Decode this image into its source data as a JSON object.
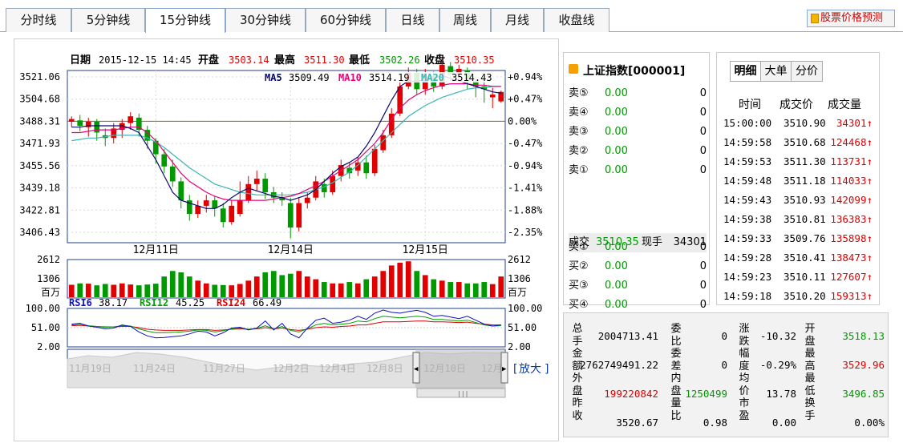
{
  "tabs": [
    "分时线",
    "5分钟线",
    "15分钟线",
    "30分钟线",
    "60分钟线",
    "日线",
    "周线",
    "月线",
    "收盘线"
  ],
  "active_tab": 2,
  "predict_label": "股票价格预测",
  "header": {
    "date_label": "日期",
    "date_value": "2015-12-15 14:45",
    "open_label": "开盘",
    "open_value": "3503.14",
    "high_label": "最高",
    "high_value": "3511.30",
    "low_label": "最低",
    "low_value": "3502.26",
    "close_label": "收盘",
    "close_value": "3510.35"
  },
  "ma": {
    "ma5_label": "MA5",
    "ma5_value": "3509.49",
    "ma10_label": "MA10",
    "ma10_value": "3514.19",
    "ma20_label": "MA20",
    "ma20_value": "3514.43"
  },
  "rsi": {
    "rsi6_label": "RSI6",
    "rsi6_value": "38.17",
    "rsi12_label": "RSI12",
    "rsi12_value": "45.25",
    "rsi24_label": "RSI24",
    "rsi24_value": "66.49"
  },
  "zoom_label": "放大",
  "nav_dates": [
    "11月19日",
    "11月24日",
    "11月27日",
    "12月2日",
    "12月4日",
    "12月8日",
    "12月10日",
    "12月"
  ],
  "colors": {
    "up": "#e00000",
    "down": "#009900",
    "ma5": "#0a0a6e",
    "ma10": "#e8007a",
    "ma20": "#3cb4b4",
    "rsi6": "#1010c8",
    "rsi12": "#00a000",
    "rsi24": "#e00000",
    "accent": "#0b3c9e"
  },
  "chart_data": {
    "type": "candlestick",
    "price_ticks": [
      "3521.06",
      "3504.68",
      "3488.31",
      "3471.93",
      "3455.56",
      "3439.18",
      "3422.81",
      "3406.43"
    ],
    "pct_ticks": [
      "+0.94%",
      "+0.47%",
      "0.00%",
      "-0.47%",
      "-0.94%",
      "-1.41%",
      "-1.88%",
      "-2.35%"
    ],
    "ylim": [
      3406.43,
      3521.06
    ],
    "prev_close": 3488.31,
    "x_ticks": [
      {
        "label": "12月11日",
        "index": 10
      },
      {
        "label": "12月14日",
        "index": 26
      },
      {
        "label": "12月15日",
        "index": 42
      }
    ],
    "candles": [
      [
        3488,
        3490,
        3492,
        3484
      ],
      [
        3489,
        3485,
        3493,
        3481
      ],
      [
        3484,
        3488,
        3491,
        3477
      ],
      [
        3488,
        3480,
        3490,
        3474
      ],
      [
        3478,
        3476,
        3483,
        3470
      ],
      [
        3476,
        3483,
        3487,
        3472
      ],
      [
        3482,
        3487,
        3490,
        3476
      ],
      [
        3487,
        3492,
        3495,
        3482
      ],
      [
        3491,
        3482,
        3494,
        3477
      ],
      [
        3482,
        3474,
        3485,
        3468
      ],
      [
        3474,
        3464,
        3476,
        3457
      ],
      [
        3464,
        3455,
        3468,
        3450
      ],
      [
        3455,
        3444,
        3460,
        3440
      ],
      [
        3444,
        3430,
        3447,
        3424
      ],
      [
        3430,
        3420,
        3434,
        3415
      ],
      [
        3420,
        3426,
        3430,
        3417
      ],
      [
        3426,
        3430,
        3434,
        3421
      ],
      [
        3430,
        3424,
        3433,
        3418
      ],
      [
        3424,
        3414,
        3428,
        3410
      ],
      [
        3414,
        3426,
        3430,
        3412
      ],
      [
        3420,
        3430,
        3444,
        3418
      ],
      [
        3430,
        3442,
        3448,
        3428
      ],
      [
        3442,
        3446,
        3452,
        3437
      ],
      [
        3446,
        3436,
        3450,
        3431
      ],
      [
        3436,
        3432,
        3440,
        3428
      ],
      [
        3432,
        3430,
        3436,
        3426
      ],
      [
        3428,
        3410,
        3432,
        3402
      ],
      [
        3410,
        3428,
        3432,
        3407
      ],
      [
        3428,
        3432,
        3436,
        3424
      ],
      [
        3432,
        3444,
        3448,
        3430
      ],
      [
        3442,
        3436,
        3446,
        3432
      ],
      [
        3436,
        3448,
        3452,
        3434
      ],
      [
        3448,
        3456,
        3460,
        3444
      ],
      [
        3454,
        3450,
        3458,
        3446
      ],
      [
        3452,
        3458,
        3462,
        3448
      ],
      [
        3458,
        3450,
        3463,
        3446
      ],
      [
        3450,
        3468,
        3471,
        3448
      ],
      [
        3467,
        3478,
        3482,
        3465
      ],
      [
        3478,
        3494,
        3498,
        3476
      ],
      [
        3494,
        3514,
        3518,
        3492
      ],
      [
        3514,
        3524,
        3528,
        3512
      ],
      [
        3524,
        3512,
        3527,
        3508
      ],
      [
        3512,
        3522,
        3527,
        3508
      ],
      [
        3522,
        3514,
        3525,
        3510
      ],
      [
        3514,
        3530,
        3534,
        3512
      ],
      [
        3529,
        3523,
        3532,
        3518
      ],
      [
        3523,
        3527,
        3530,
        3519
      ],
      [
        3526,
        3518,
        3528,
        3512
      ],
      [
        3518,
        3514,
        3522,
        3506
      ],
      [
        3514,
        3512,
        3520,
        3502
      ],
      [
        3506,
        3508,
        3513,
        3498
      ],
      [
        3503,
        3510,
        3511,
        3502
      ]
    ],
    "ma5": [
      3484,
      3484,
      3485,
      3485,
      3485,
      3485,
      3485,
      3483,
      3480,
      3470,
      3460,
      3448,
      3436,
      3430,
      3428,
      3426,
      3424,
      3424,
      3427,
      3432,
      3436,
      3439,
      3437,
      3435,
      3433,
      3432,
      3430,
      3432,
      3434,
      3438,
      3444,
      3450,
      3455,
      3458,
      3462,
      3470,
      3480,
      3492,
      3504,
      3514,
      3518,
      3518,
      3519,
      3520,
      3522,
      3520,
      3518,
      3516,
      3514,
      3512,
      3510,
      3509
    ],
    "ma10": [
      3480,
      3480,
      3481,
      3482,
      3482,
      3482,
      3483,
      3484,
      3484,
      3480,
      3474,
      3466,
      3458,
      3450,
      3444,
      3440,
      3436,
      3433,
      3431,
      3430,
      3430,
      3430,
      3430,
      3430,
      3431,
      3432,
      3433,
      3435,
      3438,
      3441,
      3444,
      3448,
      3452,
      3456,
      3460,
      3466,
      3472,
      3480,
      3490,
      3498,
      3504,
      3508,
      3511,
      3513,
      3515,
      3516,
      3516,
      3516,
      3515,
      3515,
      3514,
      3514
    ],
    "ma20": [
      3474,
      3475,
      3476,
      3476,
      3477,
      3478,
      3478,
      3478,
      3478,
      3476,
      3473,
      3469,
      3464,
      3459,
      3454,
      3450,
      3446,
      3442,
      3440,
      3438,
      3436,
      3435,
      3434,
      3434,
      3434,
      3434,
      3434,
      3435,
      3436,
      3438,
      3440,
      3443,
      3447,
      3451,
      3456,
      3462,
      3468,
      3474,
      3480,
      3486,
      3492,
      3496,
      3500,
      3503,
      3506,
      3508,
      3510,
      3512,
      3513,
      3513,
      3514,
      3514
    ],
    "volume_ticks": [
      "2612",
      "1306",
      "百万"
    ],
    "volume": [
      900,
      1000,
      980,
      860,
      960,
      900,
      1000,
      920,
      860,
      920,
      980,
      1500,
      1900,
      1800,
      1500,
      1200,
      1000,
      900,
      880,
      860,
      960,
      1200,
      1500,
      1800,
      1900,
      1600,
      1700,
      1900,
      1500,
      1300,
      1100,
      1000,
      1000,
      1100,
      1000,
      1300,
      1500,
      1900,
      2300,
      2500,
      2600,
      1900,
      1600,
      1300,
      1200,
      1100,
      1100,
      1000,
      1000,
      1100,
      950,
      1500
    ],
    "rsi_ticks": [
      "100.00",
      "51.00",
      "2.00"
    ],
    "rsi6": [
      60,
      62,
      55,
      52,
      48,
      50,
      58,
      54,
      40,
      30,
      25,
      26,
      28,
      30,
      35,
      42,
      40,
      30,
      38,
      50,
      52,
      45,
      50,
      68,
      45,
      62,
      35,
      25,
      50,
      70,
      75,
      62,
      65,
      70,
      80,
      72,
      88,
      96,
      90,
      88,
      92,
      95,
      90,
      80,
      82,
      78,
      74,
      80,
      70,
      60,
      55,
      58
    ],
    "rsi12": [
      58,
      60,
      56,
      54,
      52,
      53,
      56,
      55,
      48,
      42,
      38,
      38,
      39,
      40,
      42,
      45,
      44,
      40,
      43,
      48,
      50,
      47,
      49,
      56,
      48,
      54,
      44,
      40,
      48,
      58,
      62,
      58,
      60,
      62,
      68,
      66,
      74,
      80,
      78,
      76,
      78,
      80,
      78,
      72,
      72,
      70,
      68,
      70,
      64,
      58,
      55,
      56
    ],
    "rsi24": [
      56,
      57,
      55,
      54,
      53,
      53,
      54,
      54,
      51,
      47,
      45,
      44,
      44,
      44,
      45,
      46,
      46,
      44,
      45,
      47,
      48,
      47,
      48,
      51,
      48,
      50,
      46,
      44,
      47,
      51,
      53,
      52,
      54,
      55,
      58,
      58,
      62,
      66,
      66,
      66,
      67,
      68,
      68,
      66,
      66,
      65,
      64,
      65,
      62,
      60,
      58,
      58
    ]
  },
  "quote": {
    "title": "上证指数[000001]",
    "rows": [
      {
        "label": "卖⑤",
        "price": "0.00",
        "vol": "0"
      },
      {
        "label": "卖④",
        "price": "0.00",
        "vol": "0"
      },
      {
        "label": "卖③",
        "price": "0.00",
        "vol": "0"
      },
      {
        "label": "卖②",
        "price": "0.00",
        "vol": "0"
      },
      {
        "label": "卖①",
        "price": "0.00",
        "vol": "0"
      }
    ],
    "trade_label": "成交",
    "trade_price": "3510.35",
    "now_label": "现手",
    "now_value": "34301",
    "buy_rows": [
      {
        "label": "买①",
        "price": "0.00",
        "vol": "0"
      },
      {
        "label": "买②",
        "price": "0.00",
        "vol": "0"
      },
      {
        "label": "买③",
        "price": "0.00",
        "vol": "0"
      },
      {
        "label": "买④",
        "price": "0.00",
        "vol": "0"
      },
      {
        "label": "买⑤",
        "price": "0.00",
        "vol": "0"
      }
    ]
  },
  "trades": {
    "tabs": [
      "明细",
      "大单",
      "分价"
    ],
    "headers": [
      "时间",
      "成交价",
      "成交量"
    ],
    "rows": [
      {
        "time": "15:00:00",
        "price": "3510.90",
        "vol": "34301"
      },
      {
        "time": "14:59:58",
        "price": "3510.68",
        "vol": "124468"
      },
      {
        "time": "14:59:53",
        "price": "3511.30",
        "vol": "113731"
      },
      {
        "time": "14:59:48",
        "price": "3511.18",
        "vol": "114033"
      },
      {
        "time": "14:59:43",
        "price": "3510.93",
        "vol": "142099"
      },
      {
        "time": "14:59:38",
        "price": "3510.81",
        "vol": "136383"
      },
      {
        "time": "14:59:33",
        "price": "3509.76",
        "vol": "135898"
      },
      {
        "time": "14:59:28",
        "price": "3510.41",
        "vol": "138473"
      },
      {
        "time": "14:59:23",
        "price": "3510.11",
        "vol": "127607"
      },
      {
        "time": "14:59:18",
        "price": "3510.20",
        "vol": "159313"
      }
    ]
  },
  "stats": {
    "c1_label": "总手金额外盘昨收",
    "c1_values": [
      "2004713.41",
      "2762749491.22",
      "199220842",
      "3520.67"
    ],
    "c2_label": "委比委差内盘量比",
    "c2_values": [
      "0",
      "0",
      "1250499",
      "0.98"
    ],
    "c3_label": "涨跌幅度均价市盈",
    "c3_values": [
      "-10.32",
      "-0.29%",
      "13.78",
      "0.00"
    ],
    "c4_label": "开盘最高最低换手",
    "c4_values": [
      "3518.13",
      "3529.96",
      "3496.85",
      "0.00%"
    ]
  }
}
